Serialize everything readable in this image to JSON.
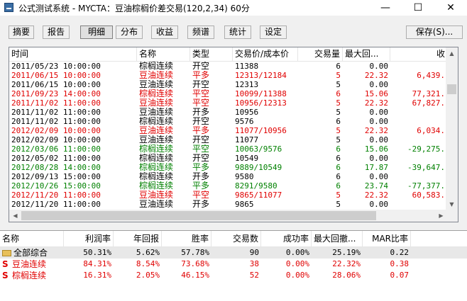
{
  "window": {
    "title": "公式测试系统 - MYCTA：豆油棕榈价差交易(120,2,34) 60分",
    "minimize": "—",
    "maximize": "☐",
    "close": "✕"
  },
  "toolbar": {
    "tabs": [
      "摘要",
      "报告",
      "明细",
      "分布",
      "收益",
      "频谱",
      "统计",
      "设定"
    ],
    "active_tab": "明细",
    "save": "保存(S)..."
  },
  "detail": {
    "columns": [
      "时间",
      "名称",
      "类型",
      "交易价/成本价",
      "交易量",
      "最大回...",
      "收"
    ],
    "rows": [
      {
        "time": "2011/05/23 10:00:00",
        "name": "棕榈连续",
        "type": "开空",
        "price": "11388",
        "qty": "6",
        "maxdd": "0.00",
        "profit": "",
        "color": "#000000"
      },
      {
        "time": "2011/06/15 10:00:00",
        "name": "豆油连续",
        "type": "平多",
        "price": "12313/12184",
        "qty": "5",
        "maxdd": "22.32",
        "profit": "6,439.",
        "color": "#e00000"
      },
      {
        "time": "2011/06/15 10:00:00",
        "name": "豆油连续",
        "type": "开空",
        "price": "12313",
        "qty": "5",
        "maxdd": "0.00",
        "profit": "",
        "color": "#000000"
      },
      {
        "time": "2011/09/23 14:00:00",
        "name": "棕榈连续",
        "type": "平空",
        "price": "10099/11388",
        "qty": "6",
        "maxdd": "15.06",
        "profit": "77,321.",
        "color": "#e00000"
      },
      {
        "time": "2011/11/02 11:00:00",
        "name": "豆油连续",
        "type": "平空",
        "price": "10956/12313",
        "qty": "5",
        "maxdd": "22.32",
        "profit": "67,827.",
        "color": "#e00000"
      },
      {
        "time": "2011/11/02 11:00:00",
        "name": "豆油连续",
        "type": "开多",
        "price": "10956",
        "qty": "5",
        "maxdd": "0.00",
        "profit": "",
        "color": "#000000"
      },
      {
        "time": "2011/11/02 11:00:00",
        "name": "棕榈连续",
        "type": "开空",
        "price": "9576",
        "qty": "6",
        "maxdd": "0.00",
        "profit": "",
        "color": "#000000"
      },
      {
        "time": "2012/02/09 10:00:00",
        "name": "豆油连续",
        "type": "平多",
        "price": "11077/10956",
        "qty": "5",
        "maxdd": "22.32",
        "profit": "6,034.",
        "color": "#e00000"
      },
      {
        "time": "2012/02/09 10:00:00",
        "name": "豆油连续",
        "type": "开空",
        "price": "11077",
        "qty": "5",
        "maxdd": "0.00",
        "profit": "",
        "color": "#000000"
      },
      {
        "time": "2012/03/06 11:00:00",
        "name": "棕榈连续",
        "type": "平空",
        "price": "10063/9576",
        "qty": "6",
        "maxdd": "15.06",
        "profit": "-29,275.",
        "color": "#008000"
      },
      {
        "time": "2012/05/02 11:00:00",
        "name": "棕榈连续",
        "type": "开空",
        "price": "10549",
        "qty": "6",
        "maxdd": "0.00",
        "profit": "",
        "color": "#000000"
      },
      {
        "time": "2012/08/28 14:00:00",
        "name": "棕榈连续",
        "type": "平多",
        "price": "9889/10549",
        "qty": "6",
        "maxdd": "17.87",
        "profit": "-39,647.",
        "color": "#008000"
      },
      {
        "time": "2012/09/13 15:00:00",
        "name": "棕榈连续",
        "type": "开多",
        "price": "9580",
        "qty": "6",
        "maxdd": "0.00",
        "profit": "",
        "color": "#000000"
      },
      {
        "time": "2012/10/26 15:00:00",
        "name": "棕榈连续",
        "type": "平多",
        "price": "8291/9580",
        "qty": "6",
        "maxdd": "23.74",
        "profit": "-77,377.",
        "color": "#008000"
      },
      {
        "time": "2012/11/20 11:00:00",
        "name": "豆油连续",
        "type": "平空",
        "price": "9865/11077",
        "qty": "5",
        "maxdd": "22.32",
        "profit": "60,583.",
        "color": "#e00000"
      },
      {
        "time": "2012/11/20 11:00:00",
        "name": "豆油连续",
        "type": "开多",
        "price": "9865",
        "qty": "5",
        "maxdd": "0.00",
        "profit": "",
        "color": "#000000"
      }
    ]
  },
  "summary": {
    "columns": [
      "名称",
      "利润率",
      "年回报",
      "胜率",
      "交易数",
      "成功率",
      "最大回撤...",
      "MAR比率"
    ],
    "rows": [
      {
        "icon": "folder-icon",
        "prefix": "",
        "name": "全部综合",
        "profit_rate": "50.31%",
        "annual": "5.62%",
        "win_rate": "57.78%",
        "trades": "90",
        "success": "0.00%",
        "max_dd": "25.19%",
        "mar": "0.22",
        "color": "#000000",
        "highlight": true
      },
      {
        "icon": "strategy-icon",
        "prefix": "S",
        "name": "豆油连续",
        "profit_rate": "84.31%",
        "annual": "8.54%",
        "win_rate": "73.68%",
        "trades": "38",
        "success": "0.00%",
        "max_dd": "22.32%",
        "mar": "0.38",
        "color": "#e00000",
        "highlight": false
      },
      {
        "icon": "strategy-icon",
        "prefix": "S",
        "name": "棕榈连续",
        "profit_rate": "16.31%",
        "annual": "2.05%",
        "win_rate": "46.15%",
        "trades": "52",
        "success": "0.00%",
        "max_dd": "28.06%",
        "mar": "0.07",
        "color": "#e00000",
        "highlight": false
      }
    ]
  }
}
